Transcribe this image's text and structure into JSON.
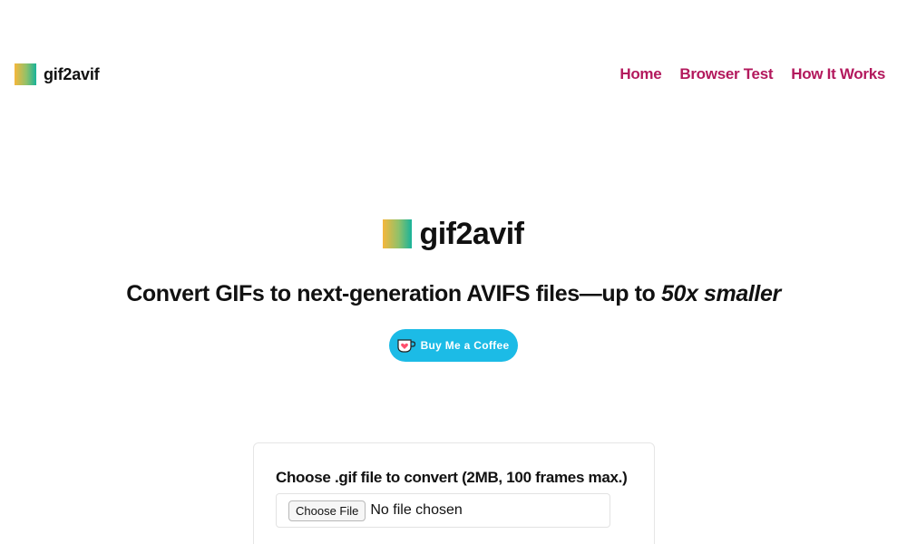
{
  "header": {
    "brand": "gif2avif",
    "nav": [
      "Home",
      "Browser Test",
      "How It Works"
    ]
  },
  "hero": {
    "brand": "gif2avif",
    "tagline_prefix": "Convert GIFs to next-generation AVIFS files—up to ",
    "tagline_emphasis": "50x smaller",
    "coffee_button": "Buy Me a Coffee"
  },
  "converter": {
    "label": "Choose .gif file to convert (2MB, 100 frames max.)",
    "choose_button": "Choose File",
    "file_status": "No file chosen"
  },
  "colors": {
    "nav_link": "#b3195d",
    "coffee_bg": "#1cbbe6",
    "logo_gradient": [
      "#f6b73c",
      "#8fc16a",
      "#18b39a"
    ]
  },
  "icons": {
    "logo": "gradient-square-logo",
    "coffee": "coffee-cup-heart-icon"
  }
}
